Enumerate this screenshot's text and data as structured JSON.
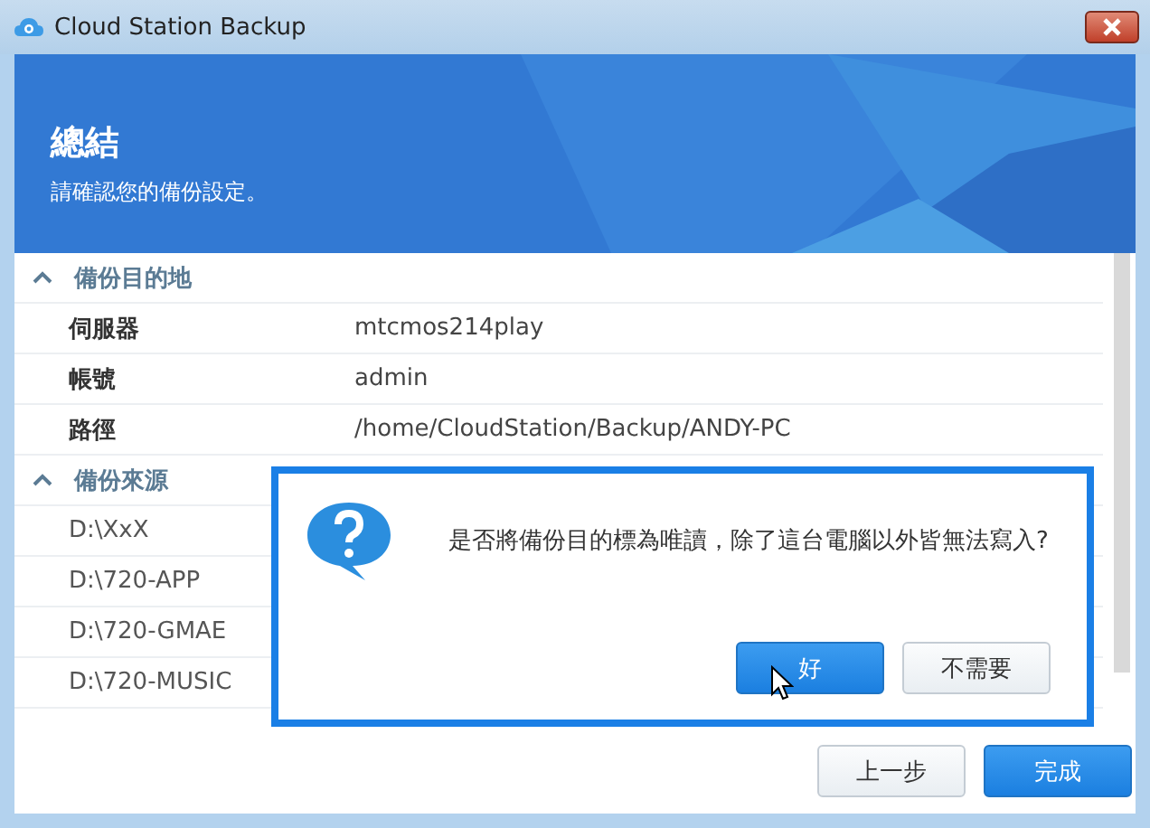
{
  "window": {
    "title": "Cloud Station Backup"
  },
  "header": {
    "title": "總結",
    "subtitle": "請確認您的備份設定。"
  },
  "sections": [
    {
      "title": "備份目的地",
      "expanded": true,
      "kind": "pairs",
      "rows": [
        {
          "label": "伺服器",
          "value": "mtcmos214play"
        },
        {
          "label": "帳號",
          "value": "admin"
        },
        {
          "label": "路徑",
          "value": "/home/CloudStation/Backup/ANDY-PC"
        }
      ]
    },
    {
      "title": "備份來源",
      "expanded": true,
      "kind": "list",
      "rows": [
        {
          "value": "D:\\XxX"
        },
        {
          "value": "D:\\720-APP"
        },
        {
          "value": "D:\\720-GMAE"
        },
        {
          "value": "D:\\720-MUSIC"
        }
      ]
    }
  ],
  "dialog": {
    "message": "是否將備份目的標為唯讀，除了這台電腦以外皆無法寫入?",
    "buttons": [
      {
        "label": "好",
        "primary": true
      },
      {
        "label": "不需要",
        "primary": false
      }
    ]
  },
  "footer": {
    "buttons": [
      {
        "label": "上一步",
        "primary": false
      },
      {
        "label": "完成",
        "primary": true
      }
    ]
  }
}
